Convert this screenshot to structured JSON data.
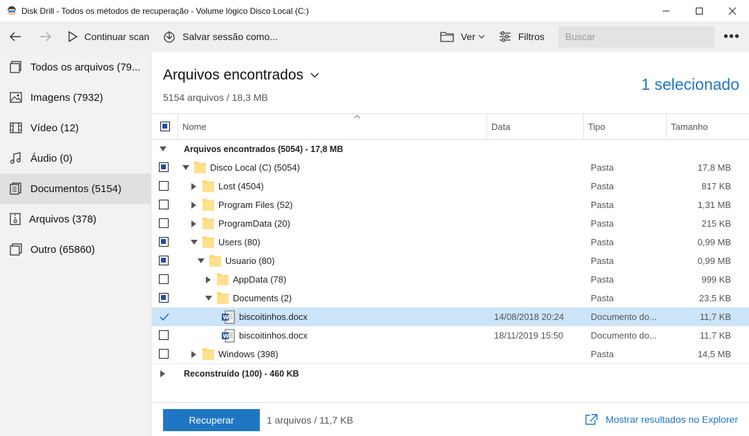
{
  "window": {
    "title": "Disk Drill - Todos os métodos de recuperação - Volume lógico Disco Local (C:)"
  },
  "toolbar": {
    "continue_label": "Continuar scan",
    "save_label": "Salvar sessão como...",
    "view_label": "Ver",
    "filters_label": "Filtros",
    "search_placeholder": "Buscar",
    "more_label": "•••"
  },
  "sidebar": {
    "items": [
      {
        "label": "Todos os arquivos (79...",
        "icon": "all-files-icon"
      },
      {
        "label": "Imagens (7932)",
        "icon": "image-icon"
      },
      {
        "label": "Vídeo (12)",
        "icon": "video-icon"
      },
      {
        "label": "Áudio (0)",
        "icon": "audio-icon"
      },
      {
        "label": "Documentos (5154)",
        "icon": "documents-icon"
      },
      {
        "label": "Arquivos (378)",
        "icon": "archive-icon"
      },
      {
        "label": "Outro (65860)",
        "icon": "other-icon"
      }
    ]
  },
  "main": {
    "title": "Arquivos encontrados",
    "subtitle": "5154 arquivos / 18,3 MB",
    "selected": "1 selecionado",
    "columns": {
      "name": "Nome",
      "date": "Data",
      "type": "Tipo",
      "size": "Tamanho"
    },
    "groups": {
      "found": "Arquivos encontrados (5054) - 17,8 MB",
      "reconstructed": "Reconstruído (100) - 460 KB"
    },
    "rows": [
      {
        "name": "Disco Local (C) (5054)",
        "date": "",
        "type": "Pasta",
        "size": "17,8 MB"
      },
      {
        "name": "Lost (4504)",
        "date": "",
        "type": "Pasta",
        "size": "817 KB"
      },
      {
        "name": "Program Files (52)",
        "date": "",
        "type": "Pasta",
        "size": "1,31 MB"
      },
      {
        "name": "ProgramData (20)",
        "date": "",
        "type": "Pasta",
        "size": "215 KB"
      },
      {
        "name": "Users (80)",
        "date": "",
        "type": "Pasta",
        "size": "0,99 MB"
      },
      {
        "name": "Usuario (80)",
        "date": "",
        "type": "Pasta",
        "size": "0,99 MB"
      },
      {
        "name": "AppData (78)",
        "date": "",
        "type": "Pasta",
        "size": "999 KB"
      },
      {
        "name": "Documents (2)",
        "date": "",
        "type": "Pasta",
        "size": "23,5 KB"
      },
      {
        "name": "biscoitinhos.docx",
        "date": "14/08/2018 20:24",
        "type": "Documento do...",
        "size": "11,7 KB"
      },
      {
        "name": "biscoitinhos.docx",
        "date": "18/11/2019 15:50",
        "type": "Documento do...",
        "size": "11,7 KB"
      },
      {
        "name": "Windows (398)",
        "date": "",
        "type": "Pasta",
        "size": "14,5 MB"
      }
    ]
  },
  "footer": {
    "recover_label": "Recuperar",
    "info": "1 arquivos / 11,7 KB",
    "explorer_label": "Mostrar resultados no Explorer"
  },
  "colors": {
    "accent": "#1f77c4",
    "selected_row": "#cce4f7",
    "folder": "#ffd76e"
  }
}
